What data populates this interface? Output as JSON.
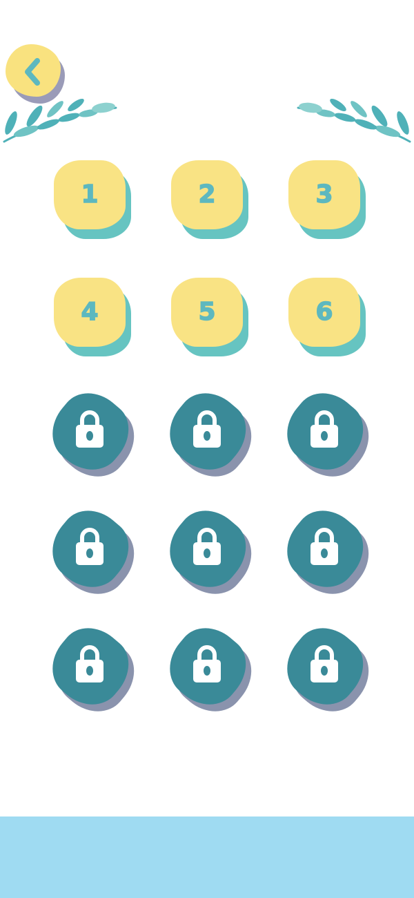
{
  "header": {
    "back_icon": "chevron-left-icon",
    "decoration_icon": "leaf-branch-icon"
  },
  "levels": [
    {
      "label": "1",
      "state": "unlocked"
    },
    {
      "label": "2",
      "state": "unlocked"
    },
    {
      "label": "3",
      "state": "unlocked"
    },
    {
      "label": "4",
      "state": "unlocked"
    },
    {
      "label": "5",
      "state": "unlocked"
    },
    {
      "label": "6",
      "state": "unlocked"
    },
    {
      "label": "",
      "state": "locked",
      "icon": "lock-icon"
    },
    {
      "label": "",
      "state": "locked",
      "icon": "lock-icon"
    },
    {
      "label": "",
      "state": "locked",
      "icon": "lock-icon"
    },
    {
      "label": "",
      "state": "locked",
      "icon": "lock-icon"
    },
    {
      "label": "",
      "state": "locked",
      "icon": "lock-icon"
    },
    {
      "label": "",
      "state": "locked",
      "icon": "lock-icon"
    },
    {
      "label": "",
      "state": "locked",
      "icon": "lock-icon"
    },
    {
      "label": "",
      "state": "locked",
      "icon": "lock-icon"
    },
    {
      "label": "",
      "state": "locked",
      "icon": "lock-icon"
    }
  ],
  "colors": {
    "unlocked_face": "#f9e384",
    "unlocked_shadow": "#66c4c1",
    "number_text": "#5db8bf",
    "locked_face": "#3a8a98",
    "locked_shadow": "#8a93ad",
    "banner": "#9fdbf2",
    "back_button": "#f9e27f"
  }
}
